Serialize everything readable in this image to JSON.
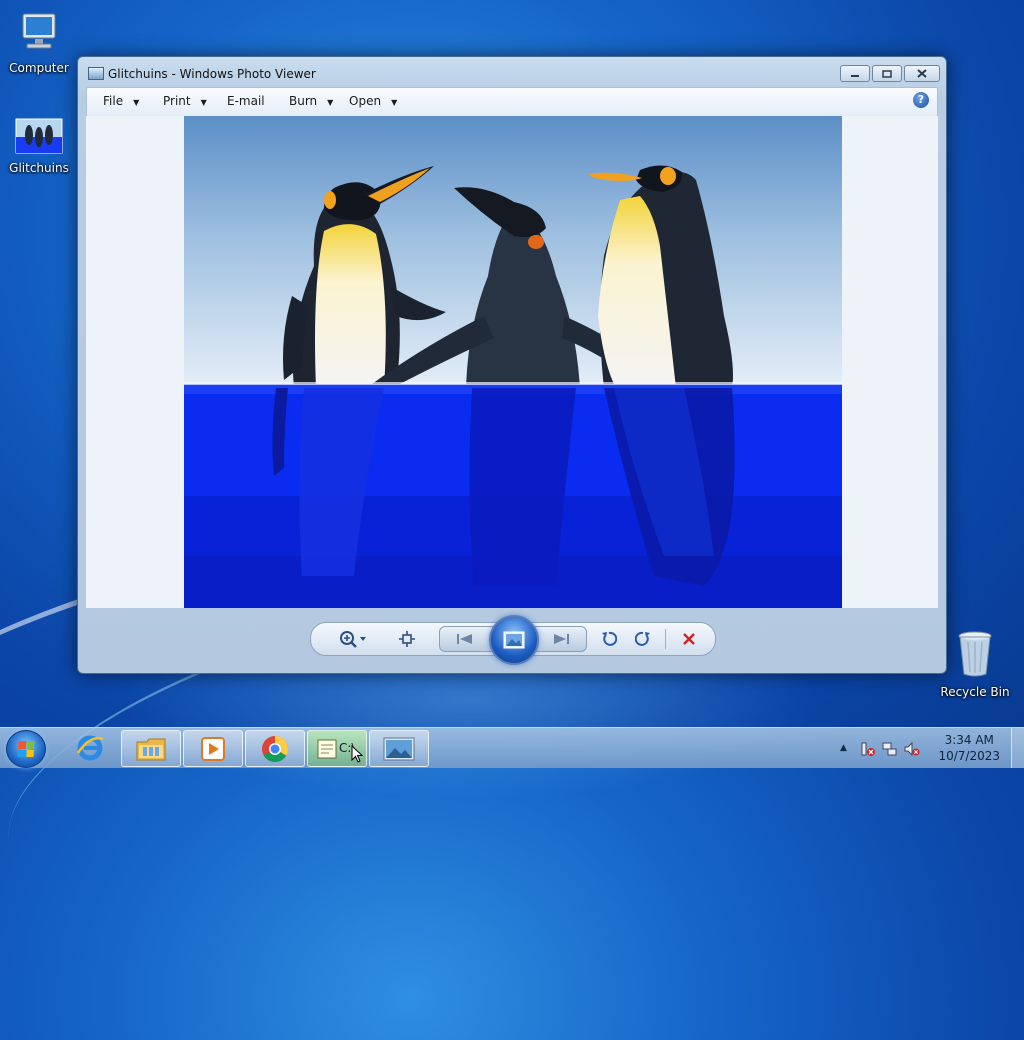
{
  "desktop": {
    "icons": [
      {
        "label": "Computer",
        "icon": "computer-icon"
      },
      {
        "label": "Glitchuins",
        "icon": "image-file-icon"
      },
      {
        "label": "Recycle Bin",
        "icon": "recycle-bin-icon"
      }
    ]
  },
  "window": {
    "title": "Glitchuins - Windows Photo Viewer",
    "caption_buttons": [
      "minimize",
      "maximize",
      "close"
    ],
    "menu": [
      {
        "label": "File",
        "has_dropdown": true
      },
      {
        "label": "Print",
        "has_dropdown": true
      },
      {
        "label": "E-mail",
        "has_dropdown": false
      },
      {
        "label": "Burn",
        "has_dropdown": true
      },
      {
        "label": "Open",
        "has_dropdown": true
      }
    ],
    "help_glyph": "?",
    "controls": [
      "zoom-icon",
      "actual-size-icon",
      "previous-icon",
      "slideshow-icon",
      "next-icon",
      "rotate-counterclockwise-icon",
      "rotate-clockwise-icon",
      "delete-icon"
    ]
  },
  "taskbar": {
    "pinned": [
      {
        "name": "internet-explorer",
        "icon": "internet-explorer-icon"
      },
      {
        "name": "windows-explorer",
        "icon": "folder-icon"
      },
      {
        "name": "media-player",
        "icon": "media-player-icon"
      },
      {
        "name": "chrome",
        "icon": "chrome-icon"
      },
      {
        "name": "command-prompt",
        "icon": "command-prompt-icon",
        "label": "C:\\"
      },
      {
        "name": "photo-viewer",
        "icon": "photo-viewer-icon"
      }
    ],
    "tray": {
      "time": "3:34 AM",
      "date": "10/7/2023"
    }
  },
  "colors": {
    "desktop_blue": "#1565c8",
    "delete_red": "#d42020",
    "glitch_blue": "#0a2cf0"
  }
}
